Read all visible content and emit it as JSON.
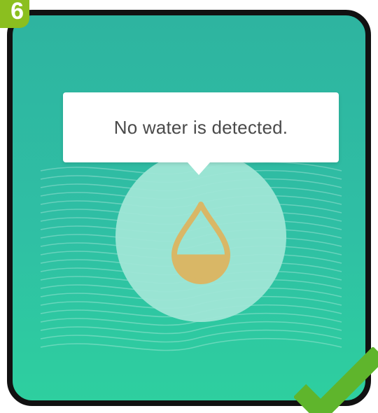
{
  "step": {
    "number": "6"
  },
  "tooltip": {
    "message": "No water is detected."
  },
  "icons": {
    "water_level": "water-drop-icon",
    "confirm": "checkmark-icon"
  },
  "colors": {
    "background": "#2fbfa4",
    "circle": "#9fe6d6",
    "drop": "#d9b766",
    "badge": "#8bbf1f",
    "check": "#5fb52c",
    "frame": "#111111"
  },
  "water_level": 0.35
}
